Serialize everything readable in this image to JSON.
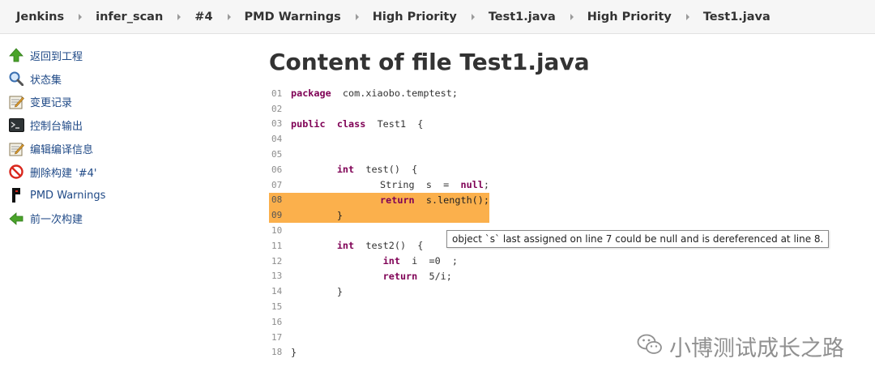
{
  "breadcrumb": [
    {
      "label": "Jenkins"
    },
    {
      "label": "infer_scan"
    },
    {
      "label": "#4"
    },
    {
      "label": "PMD Warnings"
    },
    {
      "label": "High Priority"
    },
    {
      "label": "Test1.java"
    },
    {
      "label": "High Priority"
    },
    {
      "label": "Test1.java"
    }
  ],
  "sidebar": {
    "items": [
      {
        "label": "返回到工程",
        "icon": "up-arrow-icon"
      },
      {
        "label": "状态集",
        "icon": "magnifier-icon"
      },
      {
        "label": "变更记录",
        "icon": "notepad-icon"
      },
      {
        "label": "控制台输出",
        "icon": "terminal-icon"
      },
      {
        "label": "编辑编译信息",
        "icon": "notepad-icon"
      },
      {
        "label": "删除构建 '#4'",
        "icon": "no-entry-icon"
      },
      {
        "label": "PMD Warnings",
        "icon": "pmd-icon"
      },
      {
        "label": "前一次构建",
        "icon": "left-arrow-icon"
      }
    ]
  },
  "main": {
    "title": "Content of file Test1.java",
    "code_lines": [
      {
        "no": "01",
        "text": "package  com.xiaobo.temptest;",
        "highlight": false
      },
      {
        "no": "02",
        "text": "",
        "highlight": false
      },
      {
        "no": "03",
        "text": "public  class  Test1  {",
        "highlight": false
      },
      {
        "no": "04",
        "text": "",
        "highlight": false
      },
      {
        "no": "05",
        "text": "",
        "highlight": false
      },
      {
        "no": "06",
        "text": "        int  test()  {",
        "highlight": false
      },
      {
        "no": "07",
        "text": "                String  s  =  null;",
        "highlight": false
      },
      {
        "no": "08",
        "text": "                 return  s.length();",
        "highlight": true
      },
      {
        "no": "09",
        "text": "        }",
        "highlight": true
      },
      {
        "no": "10",
        "text": "",
        "highlight": false
      },
      {
        "no": "11",
        "text": "        int  test2()  {",
        "highlight": false
      },
      {
        "no": "12",
        "text": "                int  i  =0  ;",
        "highlight": false
      },
      {
        "no": "13",
        "text": "                return  5/i;",
        "highlight": false
      },
      {
        "no": "14",
        "text": "        }",
        "highlight": false
      },
      {
        "no": "15",
        "text": "",
        "highlight": false
      },
      {
        "no": "16",
        "text": "",
        "highlight": false
      },
      {
        "no": "17",
        "text": "",
        "highlight": false
      },
      {
        "no": "18",
        "text": "}",
        "highlight": false
      }
    ],
    "keyword_color": "#7f0055",
    "highlight_color": "#fbb04c",
    "tooltip": "object `s` last assigned on line 7 could be null and is dereferenced at line 8."
  },
  "watermark": {
    "text": "小博测试成长之路",
    "icon": "wechat-icon"
  }
}
